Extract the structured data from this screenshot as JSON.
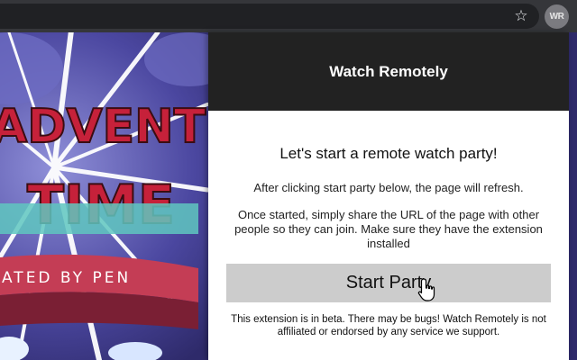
{
  "browser": {
    "star_icon": "star-outline-icon",
    "extension_badge": "WR"
  },
  "video": {
    "title_art_lines": [
      "ADVENT",
      "TIME"
    ],
    "subtitle_art": "ATED BY PEN",
    "colors": {
      "sky": "#38347a",
      "title_red": "#c6213a",
      "title_teal": "#5fc7c0",
      "ribbon": "#c43d55"
    }
  },
  "popup": {
    "title": "Watch Remotely",
    "heading": "Let's start a remote watch party!",
    "refresh_note": "After clicking start party below, the page will refresh.",
    "share_note": "Once started, simply share the URL of the page with other people so they can join. Make sure they have the extension installed",
    "start_button": "Start Party",
    "disclaimer": "This extension is in beta. There may be bugs! Watch Remotely is not affiliated or endorsed by any service we support.",
    "colors": {
      "header_bg": "#222222",
      "button_bg": "#cccccc"
    }
  }
}
